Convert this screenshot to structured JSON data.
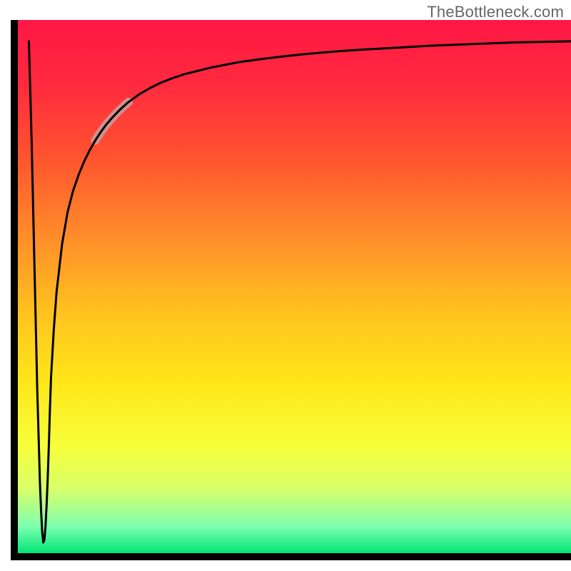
{
  "attribution": "TheBottleneck.com",
  "chart_data": {
    "type": "line",
    "title": "",
    "xlabel": "",
    "ylabel": "",
    "xlim": [
      0,
      100
    ],
    "ylim": [
      0,
      100
    ],
    "grid": false,
    "legend": false,
    "background_gradient_stops": [
      {
        "offset": 0.0,
        "color": "#ff1744"
      },
      {
        "offset": 0.12,
        "color": "#ff2a3f"
      },
      {
        "offset": 0.25,
        "color": "#ff512f"
      },
      {
        "offset": 0.4,
        "color": "#ff8a2a"
      },
      {
        "offset": 0.55,
        "color": "#ffc31e"
      },
      {
        "offset": 0.68,
        "color": "#ffe61a"
      },
      {
        "offset": 0.8,
        "color": "#f7ff3a"
      },
      {
        "offset": 0.88,
        "color": "#d8ff6a"
      },
      {
        "offset": 0.95,
        "color": "#7dffb0"
      },
      {
        "offset": 1.0,
        "color": "#00e676"
      }
    ],
    "axis_color": "#000000",
    "axis_thickness_px": 10,
    "curve_color": "#000000",
    "curve_thickness_px": 3,
    "highlight_segment": {
      "x_start": 14,
      "x_end": 20,
      "color": "#c99a97",
      "thickness_px": 12
    },
    "x": [
      2,
      2.5,
      3,
      3.5,
      4,
      4.2,
      4.4,
      4.6,
      4.8,
      5,
      5.2,
      5.4,
      5.6,
      5.8,
      6,
      6.5,
      7,
      8,
      9,
      10,
      11,
      12,
      13,
      14,
      15,
      16,
      17,
      18,
      19,
      20,
      22,
      24,
      26,
      28,
      30,
      35,
      40,
      45,
      50,
      55,
      60,
      65,
      70,
      75,
      80,
      85,
      90,
      95,
      100
    ],
    "y": [
      96,
      77,
      54,
      31,
      13,
      8,
      4,
      2,
      2.5,
      5,
      9,
      14,
      20,
      27,
      33,
      42,
      49,
      58,
      64,
      68,
      71,
      73.5,
      75.6,
      77.4,
      79.0,
      80.4,
      81.6,
      82.7,
      83.7,
      84.6,
      86.1,
      87.3,
      88.3,
      89.1,
      89.8,
      91.1,
      92.1,
      92.8,
      93.4,
      93.9,
      94.3,
      94.6,
      94.9,
      95.2,
      95.4,
      95.6,
      95.8,
      95.9,
      96.0
    ],
    "trough": {
      "x": 4.6,
      "y": 2
    }
  }
}
